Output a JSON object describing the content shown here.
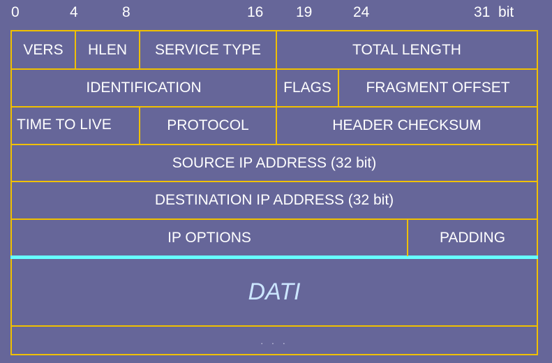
{
  "bit_scale": {
    "b0": "0",
    "b4": "4",
    "b8": "8",
    "b16": "16",
    "b19": "19",
    "b24": "24",
    "b31": "31  bit"
  },
  "rows": {
    "r1": {
      "vers": "VERS",
      "hlen": "HLEN",
      "service_type": "SERVICE TYPE",
      "total_length": "TOTAL LENGTH"
    },
    "r2": {
      "identification": "IDENTIFICATION",
      "flags": "FLAGS",
      "fragment_offset": "FRAGMENT OFFSET"
    },
    "r3": {
      "ttl": "TIME TO LIVE",
      "protocol": "PROTOCOL",
      "header_checksum": "HEADER CHECKSUM"
    },
    "r4": {
      "source": "SOURCE IP ADDRESS (32 bit)"
    },
    "r5": {
      "destination": "DESTINATION IP ADDRESS (32 bit)"
    },
    "r6": {
      "ip_options": "IP OPTIONS",
      "padding": "PADDING"
    }
  },
  "data_label": "DATI",
  "continuation": ". . .",
  "colors": {
    "background": "#666699",
    "grid_lines": "#f0c000",
    "data_separator": "#66ffff",
    "text": "#ffffff",
    "data_text": "#cce6ff"
  }
}
